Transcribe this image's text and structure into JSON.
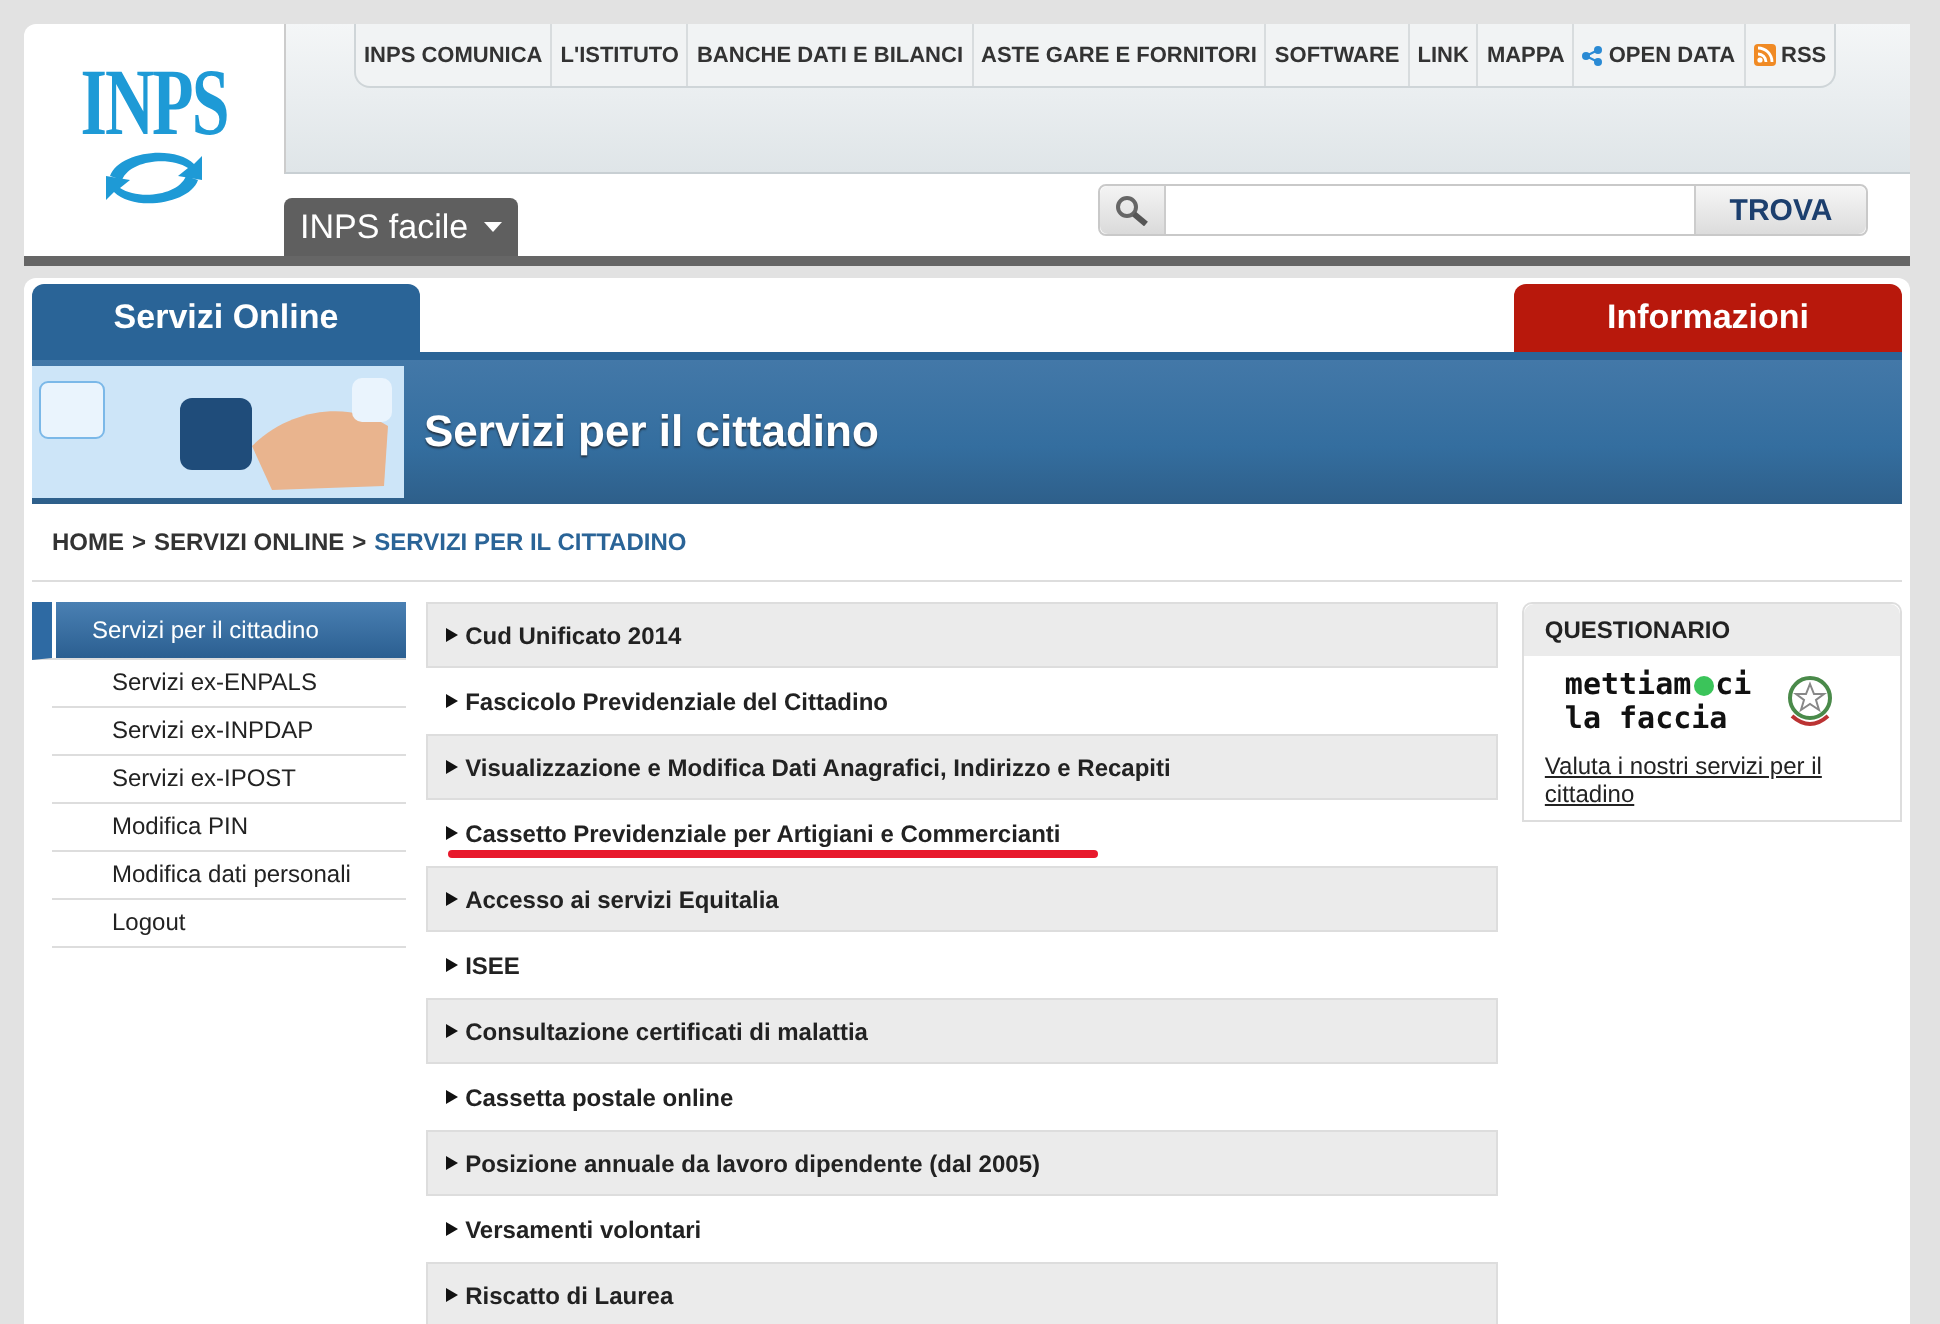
{
  "logo": {
    "text": "INPS"
  },
  "top_nav": [
    {
      "label": "INPS COMUNICA",
      "kind": "text"
    },
    {
      "label": "L'ISTITUTO",
      "kind": "text"
    },
    {
      "label": "BANCHE DATI E BILANCI",
      "kind": "text"
    },
    {
      "label": "ASTE GARE E FORNITORI",
      "kind": "text"
    },
    {
      "label": "SOFTWARE",
      "kind": "text"
    },
    {
      "label": "LINK",
      "kind": "text"
    },
    {
      "label": "MAPPA",
      "kind": "text"
    },
    {
      "label": "OPEN DATA",
      "kind": "share"
    },
    {
      "label": "RSS",
      "kind": "feed"
    }
  ],
  "facile_menu": {
    "label": "INPS facile"
  },
  "search": {
    "button": "TROVA"
  },
  "tabs": [
    {
      "label": "Servizi Online",
      "selected": true
    },
    {
      "label": "Informazioni",
      "selected": false
    }
  ],
  "banner": {
    "title": "Servizi per il cittadino"
  },
  "breadcrumb": [
    {
      "label": "HOME",
      "current": false
    },
    {
      "separator": ">"
    },
    {
      "label": "SERVIZI ONLINE",
      "current": false
    },
    {
      "separator": ">"
    },
    {
      "label": "SERVIZI PER IL CITTADINO",
      "current": true
    }
  ],
  "sidebar": {
    "items": [
      {
        "label": "Servizi per il cittadino",
        "selected": true
      },
      {
        "label": "Servizi ex-ENPALS",
        "selected": false
      },
      {
        "label": "Servizi ex-INPDAP",
        "selected": false
      },
      {
        "label": "Servizi ex-IPOST",
        "selected": false
      },
      {
        "label": "Modifica PIN",
        "selected": false
      },
      {
        "label": "Modifica dati personali",
        "selected": false
      },
      {
        "label": "Logout",
        "selected": false
      }
    ]
  },
  "services": [
    {
      "label": "Cud Unificato 2014",
      "highlighted": false
    },
    {
      "label": "Fascicolo Previdenziale del Cittadino",
      "highlighted": false
    },
    {
      "label": "Visualizzazione e Modifica Dati Anagrafici, Indirizzo e Recapiti",
      "highlighted": false
    },
    {
      "label": "Cassetto Previdenziale per Artigiani e Commercianti",
      "highlighted": true
    },
    {
      "label": "Accesso ai servizi Equitalia",
      "highlighted": false
    },
    {
      "label": "ISEE",
      "highlighted": false
    },
    {
      "label": "Consultazione certificati di malattia",
      "highlighted": false
    },
    {
      "label": "Cassetta postale online",
      "highlighted": false
    },
    {
      "label": "Posizione annuale da lavoro dipendente (dal 2005)",
      "highlighted": false
    },
    {
      "label": "Versamenti volontari",
      "highlighted": false
    },
    {
      "label": "Riscatto di Laurea",
      "highlighted": false
    }
  ],
  "questionario": {
    "title": "QUESTIONARIO",
    "logo_line_1a": "mettiam",
    "logo_line_1b": "ci",
    "logo_line_2": "la faccia",
    "link": "Valuta i nostri servizi per il cittadino"
  }
}
